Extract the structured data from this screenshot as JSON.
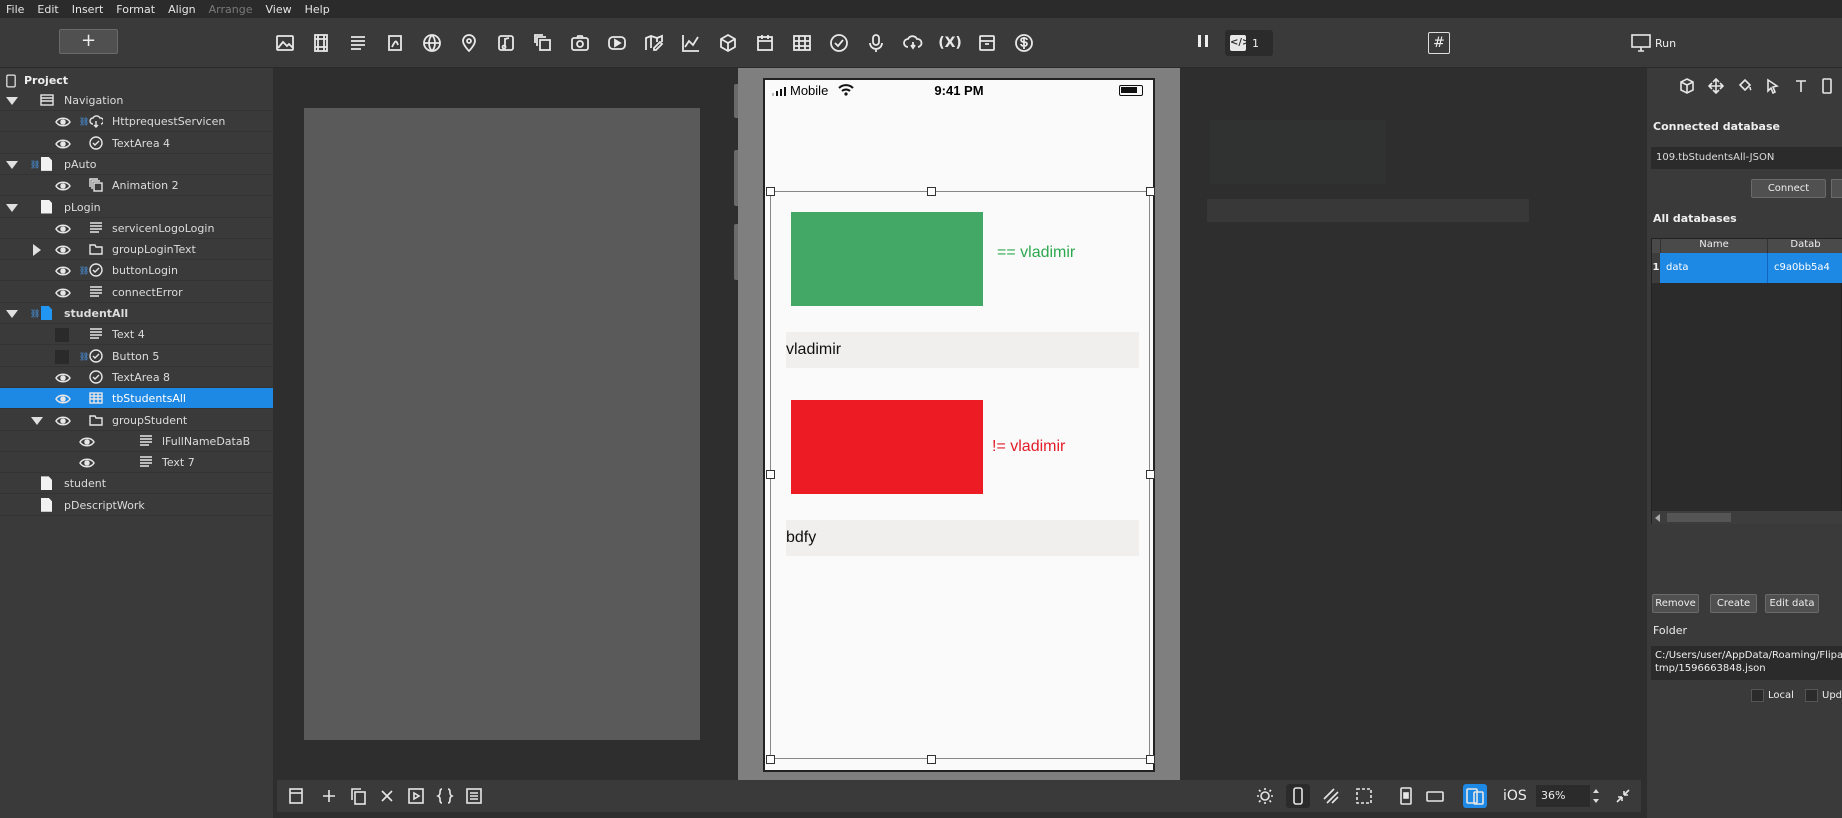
{
  "menu": [
    "File",
    "Edit",
    "Insert",
    "Format",
    "Align",
    "Arrange",
    "View",
    "Help"
  ],
  "menu_disabled": [
    "Arrange"
  ],
  "toolbar": {
    "add_label": "+",
    "icons": [
      "image-icon",
      "video-icon",
      "text-icon",
      "pdf-icon",
      "web-icon",
      "map-pin-icon",
      "music-icon",
      "copy-layers-icon",
      "camera-icon",
      "youtube-icon",
      "map-edit-icon",
      "chart-icon",
      "cube-icon",
      "calendar-icon",
      "table-icon",
      "check-circle-icon",
      "microphone-icon",
      "cloud-sync-icon",
      "variable-icon",
      "archive-icon",
      "dollar-icon"
    ],
    "variable_label": "(X)",
    "code_label": "</>",
    "code_count": "1",
    "hash_label": "#",
    "run_label": "Run"
  },
  "project": {
    "title": "Project",
    "tree": [
      {
        "label": "Navigation",
        "expanded": true,
        "kind": "nav",
        "bold": false
      },
      {
        "label": "HttprequestServicen",
        "kind": "http",
        "eye": true,
        "link": true
      },
      {
        "label": "TextArea 4",
        "kind": "check",
        "eye": true
      },
      {
        "label": "pAuto",
        "kind": "page",
        "expanded": true,
        "link": true
      },
      {
        "label": "Animation 2",
        "kind": "copy",
        "eye": true
      },
      {
        "label": "pLogin",
        "kind": "page",
        "expanded": true
      },
      {
        "label": "servicenLogoLogin",
        "kind": "text",
        "eye": true
      },
      {
        "label": "groupLoginText",
        "kind": "folder",
        "eye": true,
        "collapsed": true
      },
      {
        "label": "buttonLogin",
        "kind": "check",
        "eye": true,
        "link": true
      },
      {
        "label": "connectError",
        "kind": "text",
        "eye": true
      },
      {
        "label": "studentAll",
        "kind": "page-blue",
        "expanded": true,
        "link": true,
        "bold": true
      },
      {
        "label": "Text 4",
        "kind": "text",
        "hidden": true
      },
      {
        "label": "Button 5",
        "kind": "check",
        "hidden": true,
        "link": true
      },
      {
        "label": "TextArea 8",
        "kind": "check",
        "eye": true
      },
      {
        "label": "tbStudentsAll",
        "kind": "table",
        "eye": true,
        "selected": true
      },
      {
        "label": "groupStudent",
        "kind": "folder",
        "eye": true,
        "expanded": true
      },
      {
        "label": "lFullNameDataB",
        "kind": "text",
        "eye": true,
        "depth": 2
      },
      {
        "label": "Text 7",
        "kind": "text",
        "eye": true,
        "depth": 2
      },
      {
        "label": "student",
        "kind": "page"
      },
      {
        "label": "pDescriptWork",
        "kind": "page"
      }
    ]
  },
  "phone": {
    "carrier": "Mobile",
    "time": "9:41 PM",
    "green_text": "== vladimir",
    "field1": "vladimir",
    "red_text": "!= vladimir",
    "field2": "bdfy"
  },
  "bottom": {
    "platform": "iOS",
    "zoom": "36%"
  },
  "right": {
    "connected_title": "Connected database",
    "connected_value": "109.tbStudentsAll-JSON",
    "connect_label": "Connect",
    "all_title": "All databases",
    "col_name": "Name",
    "col_data": "Datab",
    "row_index": "1",
    "row_name": "data",
    "row_data": "c9a0bb5a4",
    "remove_label": "Remove",
    "create_label": "Create",
    "edit_label": "Edit data",
    "folder_title": "Folder",
    "folder_path_1": "C:/Users/user/AppData/Roaming/Flipab",
    "folder_path_2": "tmp/1596663848.json",
    "local_label": "Local",
    "upd_label": "Upd"
  },
  "colors": {
    "accent": "#1e88e5",
    "green_rect": "#43a866",
    "red_rect": "#ed1c24",
    "green_text": "#2ea84e",
    "red_text": "#e21d2a"
  }
}
